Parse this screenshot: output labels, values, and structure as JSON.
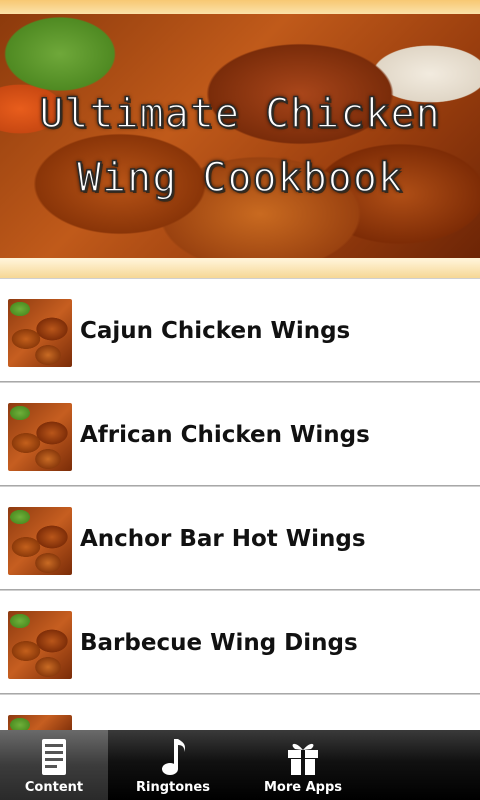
{
  "header": {
    "title_line1": "Ultimate Chicken",
    "title_line2": "Wing Cookbook"
  },
  "recipes": [
    {
      "label": "Cajun Chicken Wings"
    },
    {
      "label": "African Chicken Wings"
    },
    {
      "label": "Anchor Bar Hot Wings"
    },
    {
      "label": "Barbecue Wing Dings"
    }
  ],
  "tabs": [
    {
      "label": "Content",
      "icon": "document-icon",
      "active": true
    },
    {
      "label": "Ringtones",
      "icon": "music-note-icon",
      "active": false
    },
    {
      "label": "More Apps",
      "icon": "gift-icon",
      "active": false
    }
  ],
  "colors": {
    "tabbar_bg": "#000000",
    "active_tab_bg": "#3c3c3c",
    "banner_border": "#f7c873"
  }
}
